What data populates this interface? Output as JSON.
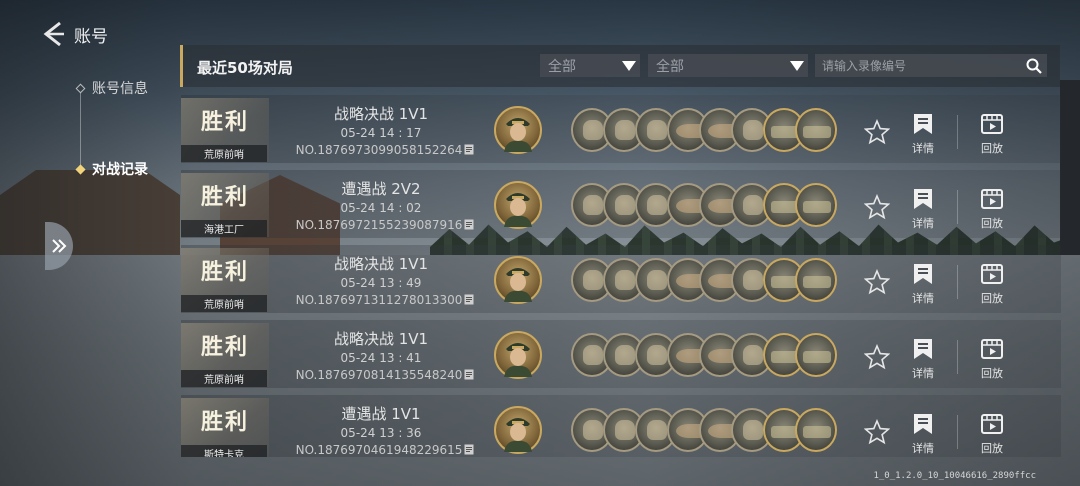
{
  "header": {
    "back_label": "账号"
  },
  "sidenav": {
    "items": [
      {
        "label": "账号信息",
        "active": false
      },
      {
        "label": "对战记录",
        "active": true
      }
    ]
  },
  "topbar": {
    "title": "最近50场对局",
    "filter1": "全部",
    "filter2": "全部",
    "search_placeholder": "请输入录像编号"
  },
  "rows": [
    {
      "result": "胜利",
      "map": "荒原前哨",
      "mode": "战略决战 1V1",
      "time": "05-24  14 : 17",
      "no": "NO.1876973099058152264",
      "detail": "详情",
      "replay": "回放"
    },
    {
      "result": "胜利",
      "map": "海港工厂",
      "mode": "遭遇战 2V2",
      "time": "05-24  14 : 02",
      "no": "NO.1876972155239087916",
      "detail": "详情",
      "replay": "回放"
    },
    {
      "result": "胜利",
      "map": "荒原前哨",
      "mode": "战略决战 1V1",
      "time": "05-24  13 : 49",
      "no": "NO.1876971311278013300",
      "detail": "详情",
      "replay": "回放"
    },
    {
      "result": "胜利",
      "map": "荒原前哨",
      "mode": "战略决战 1V1",
      "time": "05-24  13 : 41",
      "no": "NO.1876970814135548240",
      "detail": "详情",
      "replay": "回放"
    },
    {
      "result": "胜利",
      "map": "斯特卡克",
      "mode": "遭遇战 1V1",
      "time": "05-24  13 : 36",
      "no": "NO.1876970461948229615",
      "detail": "详情",
      "replay": "回放"
    }
  ],
  "unit_icons": [
    "infantry-icon",
    "infantry-icon",
    "infantry-icon",
    "machine-gun-icon",
    "artillery-icon",
    "officer-icon",
    "tank-icon",
    "tank-icon"
  ],
  "version": "1_0_1.2.0_10_10046616_2890ffcc",
  "colors": {
    "accent_gold": "#c9a860"
  }
}
